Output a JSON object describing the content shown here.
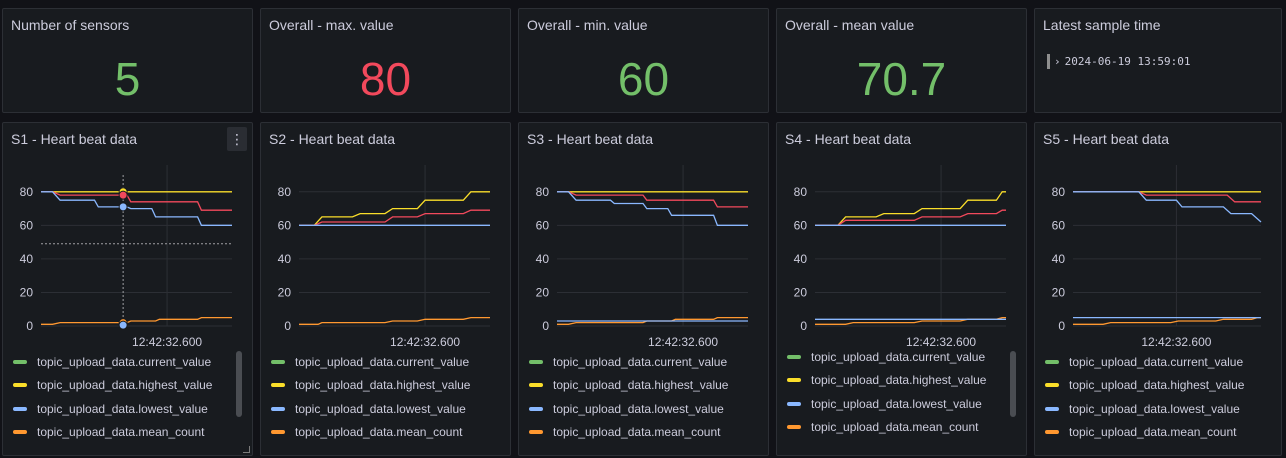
{
  "stats": [
    {
      "title": "Number of sensors",
      "value": "5",
      "color": "#73bf69"
    },
    {
      "title": "Overall - max. value",
      "value": "80",
      "color": "#f2495c"
    },
    {
      "title": "Overall - min. value",
      "value": "60",
      "color": "#73bf69"
    },
    {
      "title": "Overall - mean value",
      "value": "70.7",
      "color": "#73bf69"
    }
  ],
  "latest": {
    "title": "Latest sample time",
    "chevron": "›",
    "value": "2024-06-19 13:59:01"
  },
  "menu_icon": "⋮",
  "legend": [
    {
      "label": "topic_upload_data.current_value",
      "color": "#73bf69"
    },
    {
      "label": "topic_upload_data.highest_value",
      "color": "#fade2a"
    },
    {
      "label": "topic_upload_data.lowest_value",
      "color": "#8ab8ff"
    },
    {
      "label": "topic_upload_data.mean_count",
      "color": "#ff9830"
    }
  ],
  "series_colors": {
    "current": "#f2495c",
    "highest": "#fade2a",
    "lowest": "#8ab8ff",
    "mean": "#ff9830"
  },
  "chart_data": [
    {
      "type": "line",
      "title": "S1 - Heart beat data",
      "ylim": [
        0,
        90
      ],
      "yticks": [
        0,
        20,
        40,
        60,
        80
      ],
      "xlim": [
        0,
        1
      ],
      "xtick_label": "12:42:32.600",
      "xtick": 0.66,
      "series": [
        {
          "key": "highest",
          "x": [
            0,
            1
          ],
          "y": [
            80,
            80
          ]
        },
        {
          "key": "current",
          "x": [
            0,
            0.06,
            0.1,
            0.45,
            0.47,
            0.82,
            0.84,
            1
          ],
          "y": [
            80,
            80,
            78,
            78,
            74,
            74,
            69,
            69
          ]
        },
        {
          "key": "lowest",
          "x": [
            0,
            0.06,
            0.1,
            0.28,
            0.3,
            0.45,
            0.47,
            0.58,
            0.6,
            0.82,
            0.84,
            1
          ],
          "y": [
            80,
            80,
            75,
            75,
            71,
            71,
            70,
            70,
            65,
            65,
            60,
            60
          ]
        },
        {
          "key": "mean",
          "x": [
            0,
            0.06,
            0.1,
            0.45,
            0.47,
            0.6,
            0.62,
            0.82,
            0.84,
            1
          ],
          "y": [
            1,
            1,
            2,
            2,
            3,
            3,
            4,
            4,
            5,
            5
          ]
        }
      ]
    },
    {
      "type": "line",
      "title": "S2 - Heart beat data",
      "ylim": [
        0,
        90
      ],
      "yticks": [
        0,
        20,
        40,
        60,
        80
      ],
      "xlim": [
        0,
        1
      ],
      "xtick_label": "12:42:32.600",
      "xtick": 0.66,
      "series": [
        {
          "key": "highest",
          "x": [
            0,
            0.08,
            0.12,
            0.28,
            0.32,
            0.45,
            0.49,
            0.62,
            0.66,
            0.86,
            0.9,
            1
          ],
          "y": [
            60,
            60,
            65,
            65,
            67,
            67,
            70,
            70,
            75,
            75,
            80,
            80
          ]
        },
        {
          "key": "current",
          "x": [
            0,
            0.08,
            0.12,
            0.45,
            0.49,
            0.62,
            0.66,
            0.86,
            0.9,
            1
          ],
          "y": [
            60,
            60,
            62,
            62,
            65,
            65,
            67,
            67,
            69,
            69
          ]
        },
        {
          "key": "lowest",
          "x": [
            0,
            1
          ],
          "y": [
            60,
            60
          ]
        },
        {
          "key": "mean",
          "x": [
            0,
            0.1,
            0.12,
            0.45,
            0.49,
            0.62,
            0.66,
            0.86,
            0.9,
            1
          ],
          "y": [
            1,
            1,
            2,
            2,
            3,
            3,
            4,
            4,
            5,
            5
          ]
        }
      ]
    },
    {
      "type": "line",
      "title": "S3 - Heart beat data",
      "ylim": [
        0,
        90
      ],
      "yticks": [
        0,
        20,
        40,
        60,
        80
      ],
      "xlim": [
        0,
        1
      ],
      "xtick_label": "12:42:32.600",
      "xtick": 0.66,
      "series": [
        {
          "key": "highest",
          "x": [
            0,
            1
          ],
          "y": [
            80,
            80
          ]
        },
        {
          "key": "current",
          "x": [
            0,
            0.06,
            0.1,
            0.45,
            0.47,
            0.82,
            0.84,
            1
          ],
          "y": [
            80,
            80,
            78,
            78,
            75,
            75,
            71,
            71
          ]
        },
        {
          "key": "lowest",
          "x": [
            0,
            0.06,
            0.1,
            0.28,
            0.3,
            0.45,
            0.47,
            0.58,
            0.6,
            0.82,
            0.84,
            1
          ],
          "y": [
            80,
            80,
            75,
            75,
            73,
            73,
            70,
            70,
            66,
            66,
            60,
            60
          ]
        },
        {
          "key": "mean",
          "x": [
            0,
            0.06,
            0.1,
            0.45,
            0.47,
            0.6,
            0.62,
            0.82,
            0.84,
            1
          ],
          "y": [
            1,
            1,
            2,
            2,
            3,
            3,
            4,
            4,
            5,
            5
          ]
        },
        {
          "key": "lowest",
          "x": [
            0,
            1
          ],
          "y": [
            3,
            3
          ]
        }
      ]
    },
    {
      "type": "line",
      "title": "S4 - Heart beat data",
      "ylim": [
        0,
        90
      ],
      "yticks": [
        0,
        20,
        40,
        60,
        80
      ],
      "xlim": [
        0,
        1
      ],
      "xtick_label": "12:42:32.600",
      "xtick": 0.66,
      "series": [
        {
          "key": "highest",
          "x": [
            0,
            0.12,
            0.16,
            0.32,
            0.36,
            0.52,
            0.56,
            0.76,
            0.8,
            0.95,
            0.98,
            1
          ],
          "y": [
            60,
            60,
            65,
            65,
            67,
            67,
            70,
            70,
            75,
            75,
            80,
            80
          ]
        },
        {
          "key": "current",
          "x": [
            0,
            0.12,
            0.16,
            0.52,
            0.56,
            0.76,
            0.8,
            0.95,
            0.98,
            1
          ],
          "y": [
            60,
            60,
            63,
            63,
            65,
            65,
            67,
            67,
            69,
            69
          ]
        },
        {
          "key": "lowest",
          "x": [
            0,
            1
          ],
          "y": [
            60,
            60
          ]
        },
        {
          "key": "mean",
          "x": [
            0,
            0.16,
            0.2,
            0.52,
            0.56,
            0.76,
            0.8,
            0.95,
            0.98,
            1
          ],
          "y": [
            1,
            1,
            2,
            2,
            3,
            3,
            4,
            4,
            5,
            5
          ]
        },
        {
          "key": "lowest",
          "x": [
            0,
            1
          ],
          "y": [
            4,
            4
          ]
        }
      ]
    },
    {
      "type": "line",
      "title": "S5 - Heart beat data",
      "ylim": [
        0,
        90
      ],
      "yticks": [
        0,
        20,
        40,
        60,
        80
      ],
      "xlim": [
        0,
        1
      ],
      "xtick_label": "12:42:32.600",
      "xtick": 0.55,
      "series": [
        {
          "key": "highest",
          "x": [
            0,
            1
          ],
          "y": [
            80,
            80
          ]
        },
        {
          "key": "current",
          "x": [
            0,
            0.35,
            0.39,
            0.82,
            0.86,
            1
          ],
          "y": [
            80,
            80,
            78,
            78,
            74,
            74
          ]
        },
        {
          "key": "lowest",
          "x": [
            0,
            0.35,
            0.39,
            0.55,
            0.58,
            0.8,
            0.84,
            0.95,
            1
          ],
          "y": [
            80,
            80,
            75,
            75,
            71,
            71,
            67,
            67,
            62
          ]
        },
        {
          "key": "mean",
          "x": [
            0,
            0.16,
            0.2,
            0.52,
            0.56,
            0.76,
            0.8,
            0.95,
            0.98,
            1
          ],
          "y": [
            1,
            1,
            2,
            2,
            3,
            3,
            4,
            4,
            5,
            5
          ]
        },
        {
          "key": "lowest",
          "x": [
            0,
            1
          ],
          "y": [
            5,
            5
          ]
        }
      ]
    }
  ]
}
